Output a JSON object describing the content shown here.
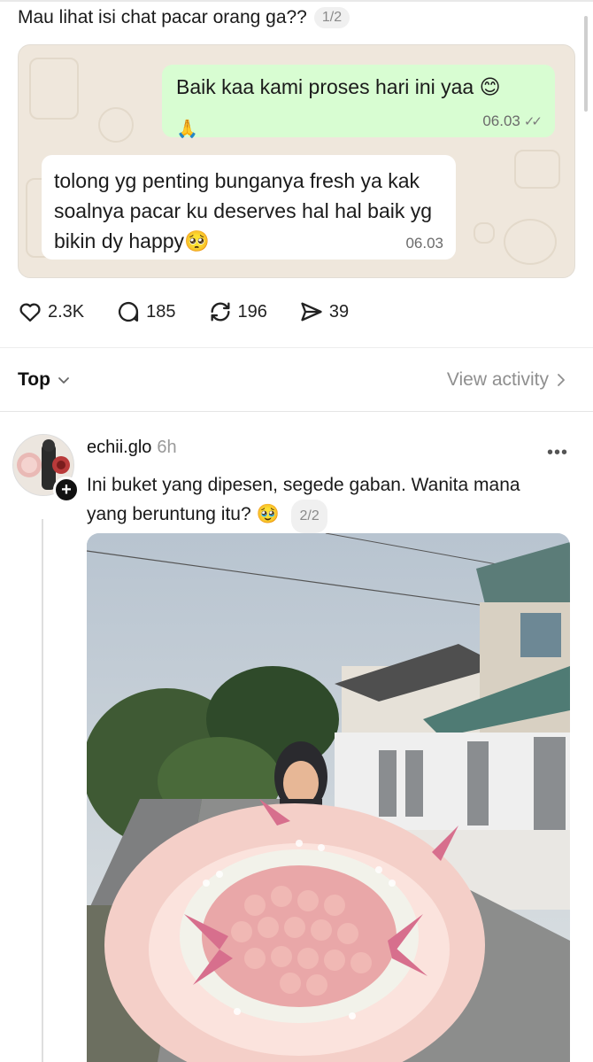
{
  "post": {
    "text": "Mau lihat isi chat pacar orang ga??",
    "pager": "1/2"
  },
  "chat": {
    "outgoing": {
      "text": "Baik kaa kami proses hari ini yaa 😊",
      "emoji_line": "🙏",
      "time": "06.03",
      "ticks": "✓✓"
    },
    "incoming": {
      "text": "tolong yg penting bunganya fresh ya kak soalnya pacar ku deserves hal hal baik yg bikin dy happy🥺",
      "time": "06.03"
    },
    "colors": {
      "outgoing_bubble": "#d8fdd2",
      "incoming_bubble": "#ffffff",
      "wallpaper": "#efe7dc"
    }
  },
  "actions": {
    "likes": "2.3K",
    "replies": "185",
    "reposts": "196",
    "shares": "39"
  },
  "sort": {
    "label": "Top",
    "view_activity": "View activity"
  },
  "reply": {
    "username": "echii.glo",
    "time_ago": "6h",
    "more": "•••",
    "text": "Ini buket yang dipesen, segede gaban. Wanita mana yang beruntung itu? 🥹",
    "pager": "2/2",
    "follow_symbol": "+"
  },
  "icons": [
    "heart-icon",
    "comment-icon",
    "repost-icon",
    "share-icon",
    "chevron-down-icon",
    "chevron-right-icon",
    "more-icon"
  ]
}
